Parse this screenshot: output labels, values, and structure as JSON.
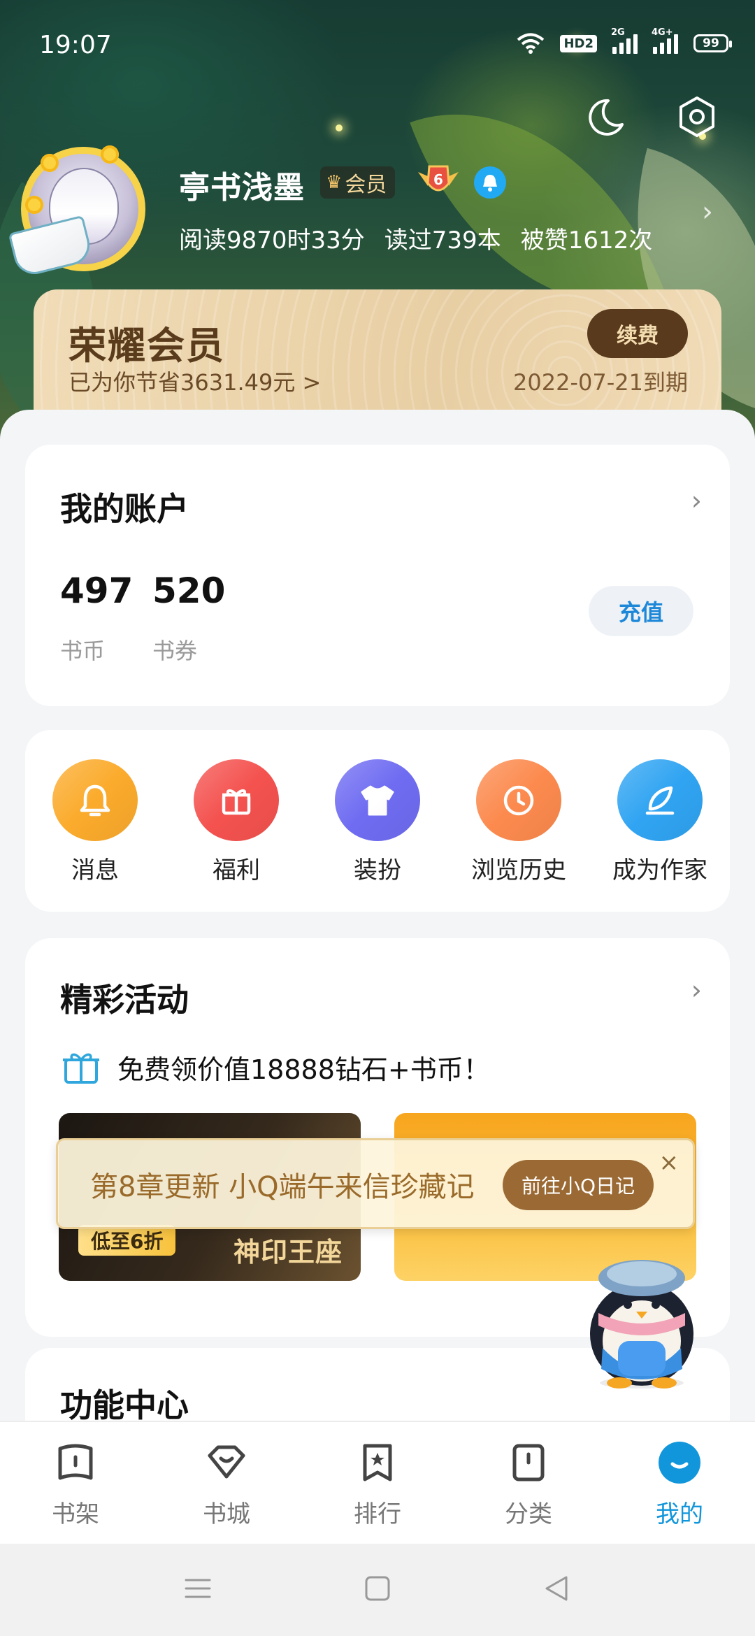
{
  "status_bar": {
    "time": "19:07",
    "hd_label": "HD2",
    "sim1_label": "2G",
    "sim2_label": "4G+",
    "battery": "99"
  },
  "profile": {
    "username": "亭书浅墨",
    "vip_label": "会员",
    "level": "6",
    "stats": [
      "阅读9870时33分",
      "读过739本",
      "被赞1612次"
    ]
  },
  "vip_card": {
    "title": "荣耀会员",
    "savings": "已为你节省3631.49元 >",
    "renew_label": "续费",
    "expiry": "2022-07-21到期"
  },
  "account": {
    "title": "我的账户",
    "coins_value": "497",
    "coins_label": "书币",
    "vouchers_value": "520",
    "vouchers_label": "书券",
    "recharge_label": "充值"
  },
  "shortcuts": [
    {
      "label": "消息",
      "icon": "bell-icon",
      "color": "#fbab2c"
    },
    {
      "label": "福利",
      "icon": "gift-icon",
      "color": "#f4524f"
    },
    {
      "label": "装扮",
      "icon": "tshirt-icon",
      "color": "#6f6cf2"
    },
    {
      "label": "浏览历史",
      "icon": "clock-icon",
      "color": "#fc8a4e"
    },
    {
      "label": "成为作家",
      "icon": "feather-icon",
      "color": "#30a4f2"
    }
  ],
  "activities": {
    "title": "精彩活动",
    "promo": "免费领价值18888钻石+书币！",
    "banner_left_tag": "低至6折",
    "banner_left_title": "神印王座"
  },
  "notice": {
    "text": "第8章更新 小Q端午来信珍藏记",
    "button": "前往小Q日记",
    "close": "×"
  },
  "function_center": {
    "title": "功能中心"
  },
  "bottom_nav": [
    {
      "label": "书架",
      "active": false
    },
    {
      "label": "书城",
      "active": false
    },
    {
      "label": "排行",
      "active": false
    },
    {
      "label": "分类",
      "active": false
    },
    {
      "label": "我的",
      "active": true
    }
  ],
  "colors": {
    "accent": "#1296db",
    "vip_brown": "#5a3a1c",
    "hero_green": "#1f4a3b"
  }
}
